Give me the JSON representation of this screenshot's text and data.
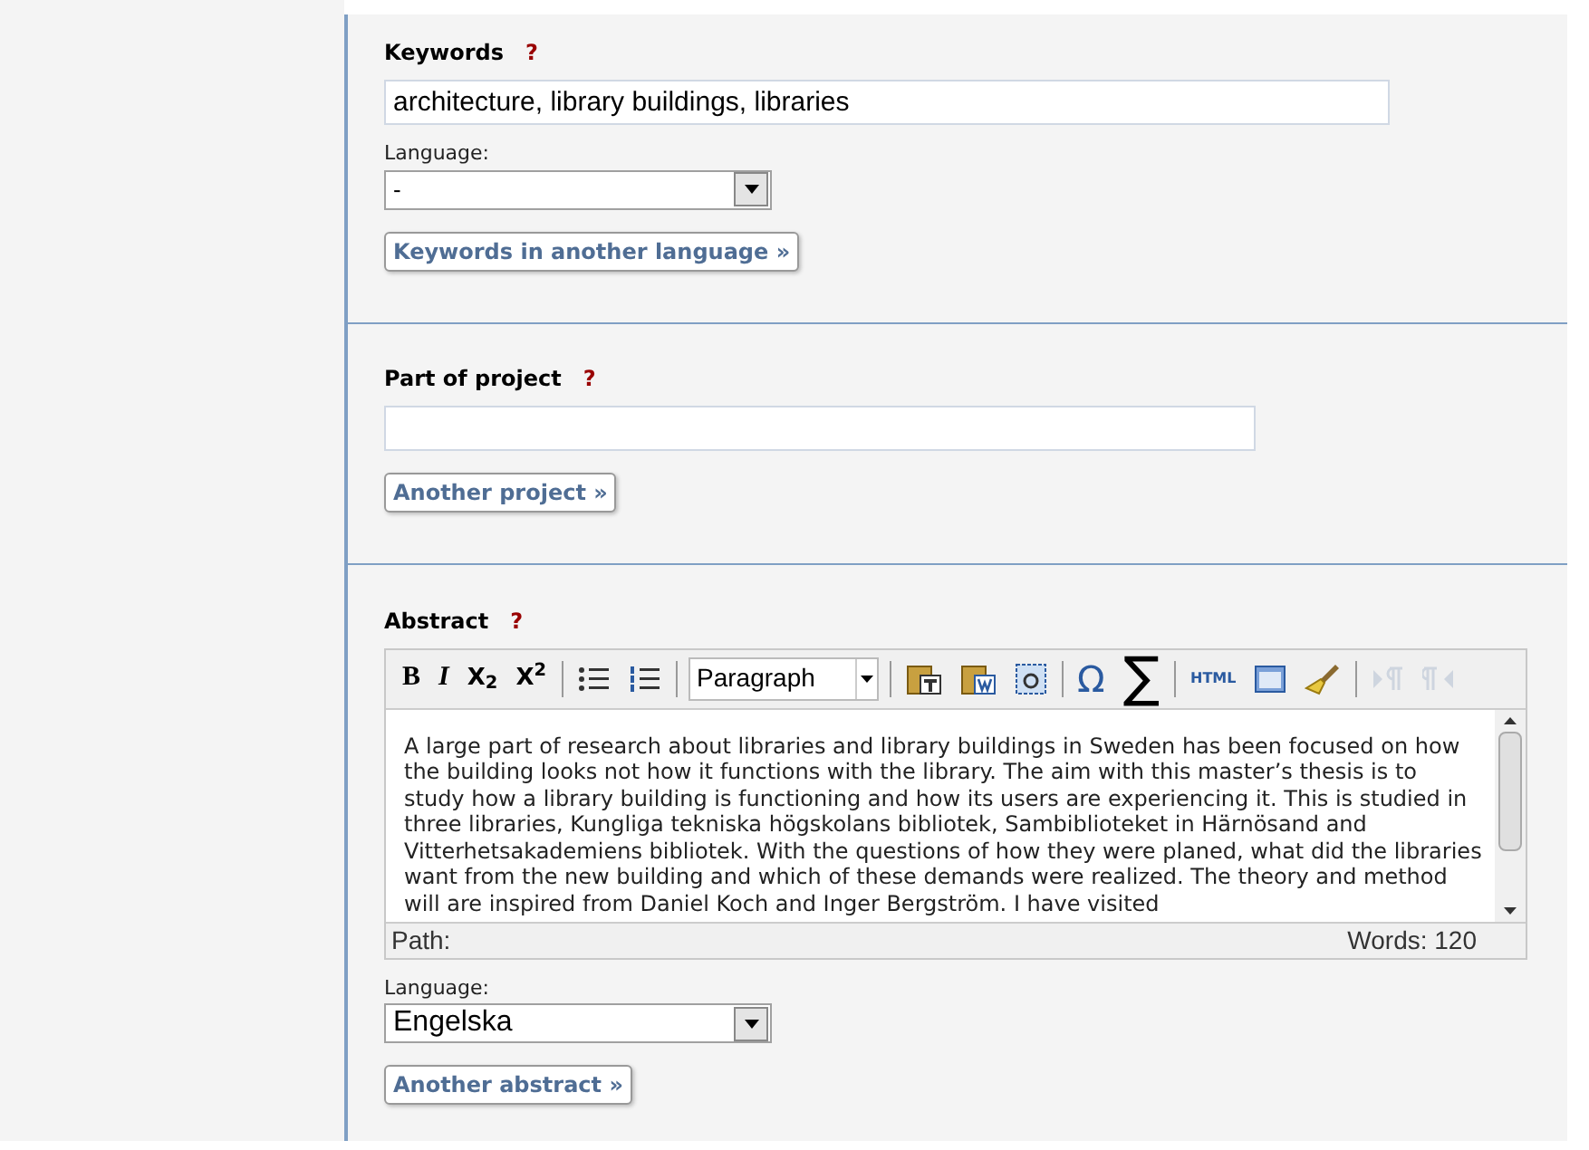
{
  "sections": [
    {
      "kind": "keywords",
      "label": "Keywords",
      "help": "?",
      "value": "architecture, library buildings, libraries",
      "language": {
        "label": "Language:",
        "value": "-"
      },
      "button": "Keywords in another language »"
    },
    {
      "kind": "project",
      "label": "Part of project",
      "help": "?",
      "button": "Another project »"
    },
    {
      "kind": "abstract",
      "label": "Abstract",
      "help": "?",
      "editor": {
        "toolbar": [
          {
            "kind": "text",
            "label": "B",
            "disabled": false
          },
          {
            "kind": "text",
            "label": "I",
            "disabled": false
          },
          {
            "kind": "text",
            "label": "X$_{2}$",
            "disabled": false
          },
          {
            "kind": "text",
            "label": "X$^{2}$",
            "disabled": false
          },
          {
            "kind": "sep"
          },
          {
            "kind": "icon",
            "disabled": false
          },
          {
            "kind": "icon",
            "disabled": false
          },
          {
            "kind": "sep"
          },
          {
            "kind": "select",
            "value": "Paragraph"
          },
          {
            "kind": "sep"
          },
          {
            "kind": "icon",
            "disabled": false
          },
          {
            "kind": "icon",
            "disabled": false
          },
          {
            "kind": "icon",
            "disabled": false
          },
          {
            "kind": "sep"
          },
          {
            "kind": "text",
            "label": "Ω",
            "disabled": false
          },
          {
            "kind": "text",
            "label": "∑",
            "disabled": false
          },
          {
            "kind": "sep"
          },
          {
            "kind": "text",
            "label": "HTML",
            "disabled": false
          },
          {
            "kind": "icon",
            "disabled": false
          },
          {
            "kind": "icon",
            "disabled": false
          },
          {
            "kind": "sep"
          },
          {
            "kind": "icon",
            "disabled": true
          },
          {
            "kind": "icon",
            "disabled": true
          }
        ],
        "text": "A large part of research about libraries and library buildings in Sweden has been focused on how the building looks not how it functions with the library. The aim with this master’s thesis is to study how a library building is functioning and how its users are experiencing it. This is studied in three libraries, Kungliga tekniska högskolans bibliotek, Sambiblioteket in Härnösand and Vitterhetsakademiens bibliotek. With the questions of how they were planed, what did the libraries want from the new building and which of these demands were realized. The theory and method will are inspired from Daniel Koch and Inger Bergström. I have visited",
        "path": "Path:",
        "words": "Words: 120"
      },
      "language": {
        "label": "Language:",
        "value": "Engelska"
      },
      "button": "Another abstract »"
    }
  ]
}
